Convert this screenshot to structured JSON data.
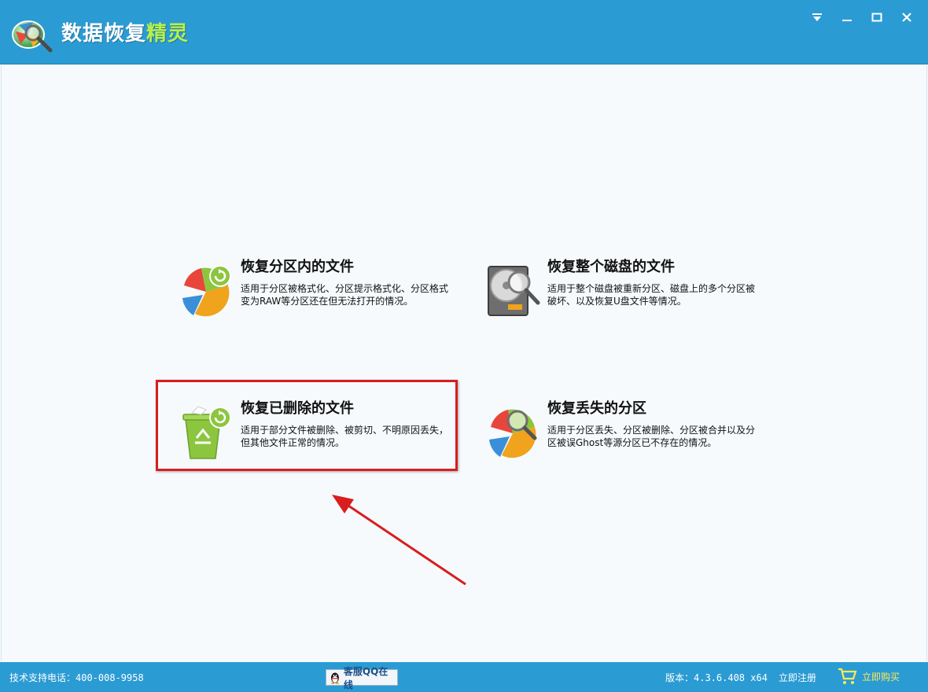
{
  "app": {
    "title_main": "数据恢复",
    "title_accent": "精灵"
  },
  "window_controls": {
    "menu_icon": "dropdown-menu-icon",
    "minimize_icon": "minimize-icon",
    "maximize_icon": "maximize-icon",
    "close_icon": "close-icon"
  },
  "cards": [
    {
      "title": "恢复分区内的文件",
      "desc": "适用于分区被格式化、分区提示格式化、分区格式变为RAW等分区还在但无法打开的情况。",
      "icon": "pie-chart-refresh-icon"
    },
    {
      "title": "恢复整个磁盘的文件",
      "desc": "适用于整个磁盘被重新分区、磁盘上的多个分区被破坏、以及恢复U盘文件等情况。",
      "icon": "hard-disk-magnifier-icon"
    },
    {
      "title": "恢复已删除的文件",
      "desc": "适用于部分文件被删除、被剪切、不明原因丢失，但其他文件正常的情况。",
      "icon": "recycle-bin-refresh-icon"
    },
    {
      "title": "恢复丢失的分区",
      "desc": "适用于分区丢失、分区被删除、分区被合并以及分区被误Ghost等源分区已不存在的情况。",
      "icon": "pie-chart-magnifier-icon"
    }
  ],
  "statusbar": {
    "support": "技术支持电话：400-008-9958",
    "qq_label": "客服QQ在线",
    "version": "版本：4.3.6.408 x64",
    "register": "立即注册",
    "buy": "立即购买"
  },
  "colors": {
    "titlebar": "#2b9bd3",
    "accent_green": "#b8f04a",
    "highlight_red": "#d81e1e"
  }
}
